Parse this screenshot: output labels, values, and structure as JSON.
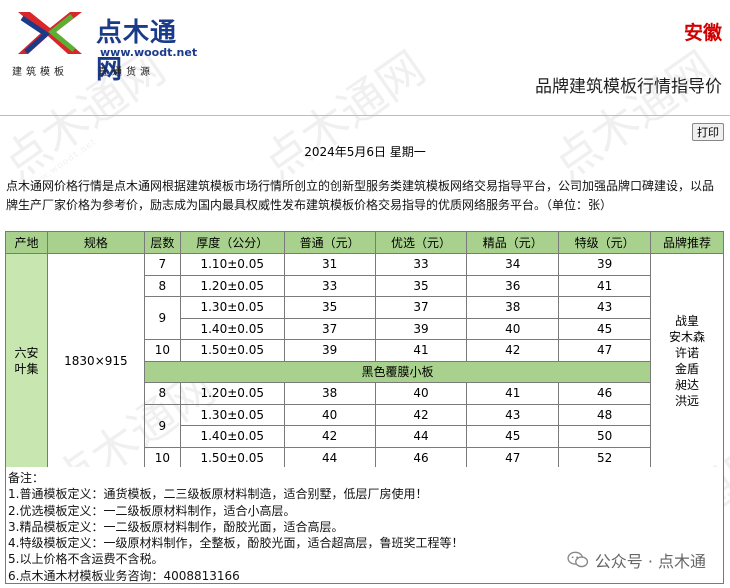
{
  "brand": {
    "name": "点木通网",
    "url": "www.woodt.net",
    "tagline_left": "建筑模板",
    "tagline_right": "直通货源"
  },
  "header": {
    "province": "安徽",
    "subtitle": "品牌建筑模板行情指导价"
  },
  "toolbar": {
    "print_label": "打印"
  },
  "date": "2024年5月6日 星期一",
  "intro": "点木通网价格行情是点木通网根据建筑模板市场行情所创立的创新型服务类建筑模板网络交易指导平台，公司加强品牌口碑建设，以品牌生产厂家价格为参考价，励志成为国内最具权威性发布建筑模板价格交易指导的优质网络服务平台。（单位：张）",
  "table": {
    "headers": [
      "产地",
      "规格",
      "层数",
      "厚度（公分）",
      "普通（元）",
      "优选（元）",
      "精品（元）",
      "特级（元）",
      "品牌推荐"
    ],
    "origin": "六安叶集",
    "spec": "1830×915",
    "band_label": "黑色覆膜小板",
    "brands": [
      "战皇",
      "安木森",
      "许诺",
      "金盾",
      "昶达",
      "洪远"
    ],
    "group_a": [
      {
        "layers": "7",
        "thickness": "1.10±0.05",
        "regular": "31",
        "preferred": "33",
        "premium": "34",
        "special": "39"
      },
      {
        "layers": "8",
        "thickness": "1.20±0.05",
        "regular": "33",
        "preferred": "35",
        "premium": "36",
        "special": "41"
      },
      {
        "layers": "9",
        "thickness": "1.30±0.05",
        "regular": "35",
        "preferred": "37",
        "premium": "38",
        "special": "43"
      },
      {
        "layers": "",
        "thickness": "1.40±0.05",
        "regular": "37",
        "preferred": "39",
        "premium": "40",
        "special": "45"
      },
      {
        "layers": "10",
        "thickness": "1.50±0.05",
        "regular": "39",
        "preferred": "41",
        "premium": "42",
        "special": "47"
      }
    ],
    "group_b": [
      {
        "layers": "8",
        "thickness": "1.20±0.05",
        "regular": "38",
        "preferred": "40",
        "premium": "41",
        "special": "46"
      },
      {
        "layers": "9",
        "thickness": "1.30±0.05",
        "regular": "40",
        "preferred": "42",
        "premium": "43",
        "special": "48"
      },
      {
        "layers": "",
        "thickness": "1.40±0.05",
        "regular": "42",
        "preferred": "44",
        "premium": "45",
        "special": "50"
      },
      {
        "layers": "10",
        "thickness": "1.50±0.05",
        "regular": "44",
        "preferred": "46",
        "premium": "47",
        "special": "52"
      }
    ]
  },
  "notes": {
    "title": "备注：",
    "lines": [
      "1.普通模板定义：通货模板，二三级板原材料制造，适合别墅，低层厂房使用！",
      "2.优选模板定义：一二级板原材料制作，适合小高层。",
      "3.精品模板定义：一二级板原材料制作，酚胶光面，适合高层。",
      "4.特级模板定义：一级原材料制作，全整板，酚胶光面，适合超高层，鲁班奖工程等！",
      "5.以上价格不含运费不含税。",
      "6.点木通木材模板业务咨询：4008813166"
    ]
  },
  "wechat": {
    "label": "公众号 · 点木通"
  },
  "watermark": {
    "text": "点木通网",
    "url": "www.woodt.net"
  },
  "colors": {
    "header_bg": "#a9d18e",
    "side_bg": "#c8e6b0",
    "province": "#d00000",
    "brand_blue": "#1a3a8a",
    "logo_red": "#d9262b",
    "logo_green": "#5ab032"
  }
}
